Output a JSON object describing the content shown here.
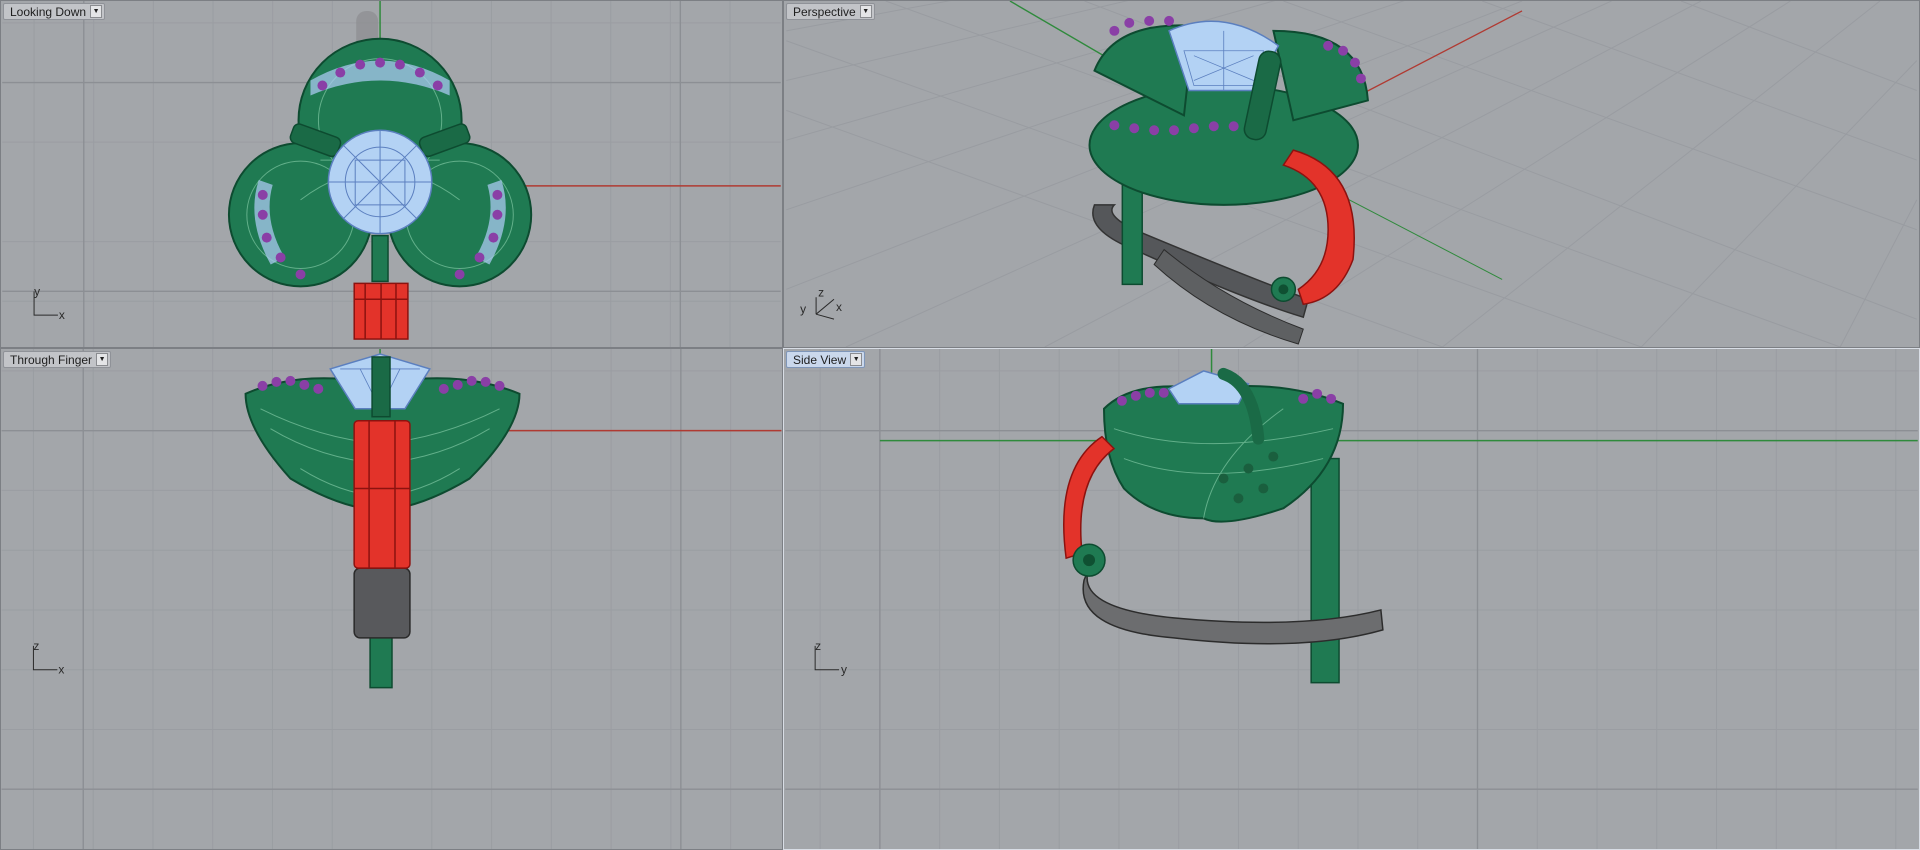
{
  "viewports": [
    {
      "id": "top",
      "title": "Looking Down",
      "active": false,
      "axes": [
        "y",
        "x"
      ]
    },
    {
      "id": "perspective",
      "title": "Perspective",
      "active": false,
      "axes": [
        "z",
        "y",
        "x"
      ]
    },
    {
      "id": "front",
      "title": "Through Finger",
      "active": false,
      "axes": [
        "z",
        "x"
      ]
    },
    {
      "id": "right",
      "title": "Side View",
      "active": true,
      "axes": [
        "z",
        "y"
      ]
    }
  ],
  "icons": {
    "menu": "chevron-down-icon"
  },
  "colors": {
    "background": "#a3a6aa",
    "grid_minor": "#9a9da2",
    "grid_major": "#8c8f94",
    "axis_x": "#b03a32",
    "axis_y": "#2f8a3c",
    "body": "#1f7a52",
    "gem": "#a9c9f0",
    "stones": "#8a3fa6",
    "selected": "#e3332a",
    "band": "#6a6a6a"
  }
}
